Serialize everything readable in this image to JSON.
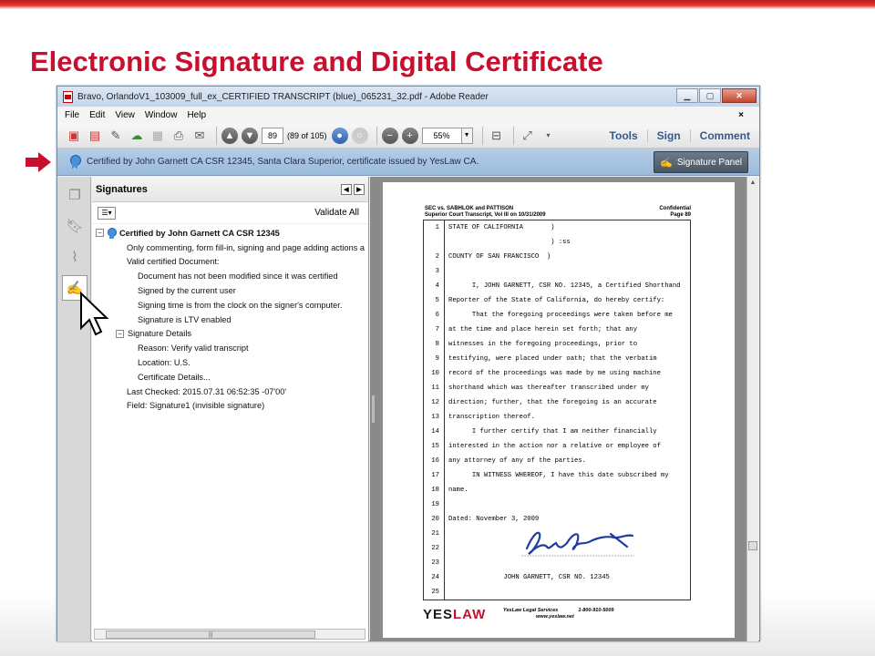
{
  "slide": {
    "title": "Electronic Signature and Digital Certificate"
  },
  "window": {
    "title": "Bravo, OrlandoV1_103009_full_ex_CERTIFIED TRANSCRIPT (blue)_065231_32.pdf - Adobe Reader"
  },
  "menu": [
    "File",
    "Edit",
    "View",
    "Window",
    "Help"
  ],
  "toolbar": {
    "page_number": "89",
    "page_count": "(89 of 105)",
    "zoom": "55%",
    "tools_label": "Tools",
    "sign_label": "Sign",
    "comment_label": "Comment"
  },
  "cert_bar": {
    "message": "Certified by John Garnett CA CSR 12345, Santa Clara Superior, certificate issued by YesLaw CA.",
    "button_label": "Signature Panel"
  },
  "signatures_panel": {
    "title": "Signatures",
    "validate_all": "Validate All",
    "tree": [
      {
        "text": "Certified by John Garnett CA CSR 12345",
        "level": 0,
        "expander": "⊟",
        "bold": true
      },
      {
        "text": "Only commenting, form fill-in, signing and page adding actions a",
        "level": 1
      },
      {
        "text": "Valid certified Document:",
        "level": 1
      },
      {
        "text": "Document has not been modified since it was certified",
        "level": 2
      },
      {
        "text": "Signed by the current user",
        "level": 2
      },
      {
        "text": "Signing time is from the clock on the signer's computer.",
        "level": 2
      },
      {
        "text": "Signature is LTV enabled",
        "level": 2
      },
      {
        "text": "Signature Details",
        "level": 1,
        "expander": "⊟"
      },
      {
        "text": "Reason: Verify valid transcript",
        "level": 2
      },
      {
        "text": "Location: U.S.",
        "level": 2
      },
      {
        "text": "Certificate Details...",
        "level": 2
      },
      {
        "text": "Last Checked: 2015.07.31 06:52:35 -07'00'",
        "level": 1
      },
      {
        "text": "Field: Signature1 (invisible signature)",
        "level": 1
      }
    ]
  },
  "document": {
    "case_header": [
      "SEC vs. SABHLOK and PATTISON",
      "Superior Court Transcript, Vol III on 10/31/2009"
    ],
    "conf_header": [
      "Confidential",
      "Page 89"
    ],
    "lines": [
      {
        "n": "1",
        "text": "STATE OF CALIFORNIA       )"
      },
      {
        "n": "",
        "text": "                          ) :ss"
      },
      {
        "n": "2",
        "text": "COUNTY OF SAN FRANCISCO  )"
      },
      {
        "n": "3",
        "text": ""
      },
      {
        "n": "4",
        "text": "      I, JOHN GARNETT, CSR NO. 12345, a Certified Shorthand"
      },
      {
        "n": "5",
        "text": "Reporter of the State of California, do hereby certify:"
      },
      {
        "n": "6",
        "text": "      That the foregoing proceedings were taken before me"
      },
      {
        "n": "7",
        "text": "at the time and place herein set forth; that any"
      },
      {
        "n": "8",
        "text": "witnesses in the foregoing proceedings, prior to"
      },
      {
        "n": "9",
        "text": "testifying, were placed under oath; that the verbatim"
      },
      {
        "n": "10",
        "text": "record of the proceedings was made by me using machine"
      },
      {
        "n": "11",
        "text": "shorthand which was thereafter transcribed under my"
      },
      {
        "n": "12",
        "text": "direction; further, that the foregoing is an accurate"
      },
      {
        "n": "13",
        "text": "transcription thereof."
      },
      {
        "n": "14",
        "text": "      I further certify that I am neither financially"
      },
      {
        "n": "15",
        "text": "interested in the action nor a relative or employee of"
      },
      {
        "n": "16",
        "text": "any attorney of any of the parties."
      },
      {
        "n": "17",
        "text": "      IN WITNESS WHEREOF, I have this date subscribed my"
      },
      {
        "n": "18",
        "text": "name."
      },
      {
        "n": "19",
        "text": ""
      },
      {
        "n": "20",
        "text": "Dated: November 3, 2009"
      },
      {
        "n": "21",
        "text": ""
      },
      {
        "n": "22",
        "text": ""
      },
      {
        "n": "23",
        "text": ""
      },
      {
        "n": "24",
        "text": "              JOHN GARNETT, CSR NO. 12345"
      },
      {
        "n": "25",
        "text": ""
      }
    ],
    "footer": {
      "logo_yes": "YES",
      "logo_law": "LAW",
      "company": "YesLaw Legal Services",
      "phone": "1-800-910-5009",
      "url": "www.yeslaw.net"
    }
  },
  "colors": {
    "accent": "#c8102e",
    "cert_bar": "#a9c4e2",
    "link": "#345a8c"
  }
}
